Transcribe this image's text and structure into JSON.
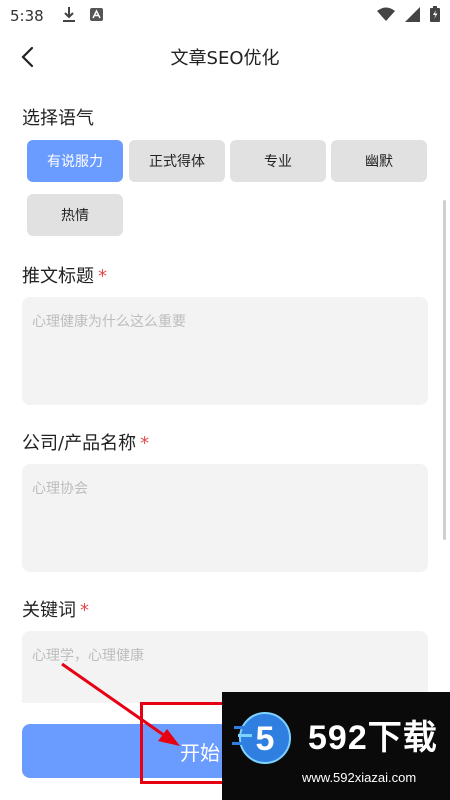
{
  "status_bar": {
    "time": "5:38"
  },
  "header": {
    "title": "文章SEO优化"
  },
  "tone_section": {
    "label": "选择语气",
    "options": [
      "有说服力",
      "正式得体",
      "专业",
      "幽默",
      "热情"
    ]
  },
  "title_field": {
    "label": "推文标题",
    "required_mark": "*",
    "placeholder": "心理健康为什么这么重要"
  },
  "company_field": {
    "label": "公司/产品名称",
    "required_mark": "*",
    "placeholder": "心理协会"
  },
  "keywords_field": {
    "label": "关键词",
    "required_mark": "*",
    "placeholder": "心理学，心理健康"
  },
  "start_button": {
    "label": "开始"
  },
  "watermark": {
    "logo_text": "592下载",
    "url": "www.592xiazai.com",
    "logo_digit": "5"
  },
  "colors": {
    "accent": "#6a9cff",
    "required": "#e5484d",
    "annotation": "#e60012"
  }
}
